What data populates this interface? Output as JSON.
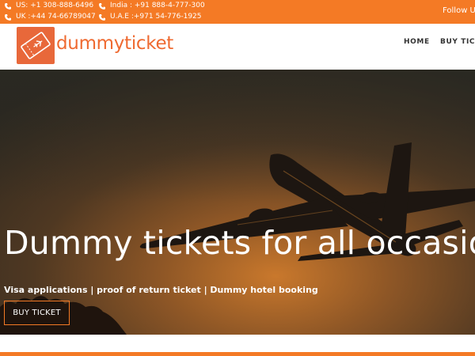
{
  "topbar": {
    "contacts": [
      {
        "text": "US: +1 308-888-6496"
      },
      {
        "text": "UK :+44 74-66789047"
      },
      {
        "text": "India : +91 888-4-777-300"
      },
      {
        "text": "U.A.E :+971 54-776-1925"
      }
    ],
    "follow": "Follow Us:"
  },
  "header": {
    "logo_text": "dummyticket",
    "nav": [
      {
        "label": "HOME"
      },
      {
        "label": "BUY TICKET"
      }
    ]
  },
  "hero": {
    "title": "Dummy tickets for all occasions",
    "subtitle": "Visa applications | proof of return ticket | Dummy hotel booking",
    "button": "BUY TICKET"
  },
  "colors": {
    "accent": "#f47a25",
    "logo": "#e8683a"
  },
  "icons": [
    "phone-icon",
    "ticket-logo-icon"
  ]
}
